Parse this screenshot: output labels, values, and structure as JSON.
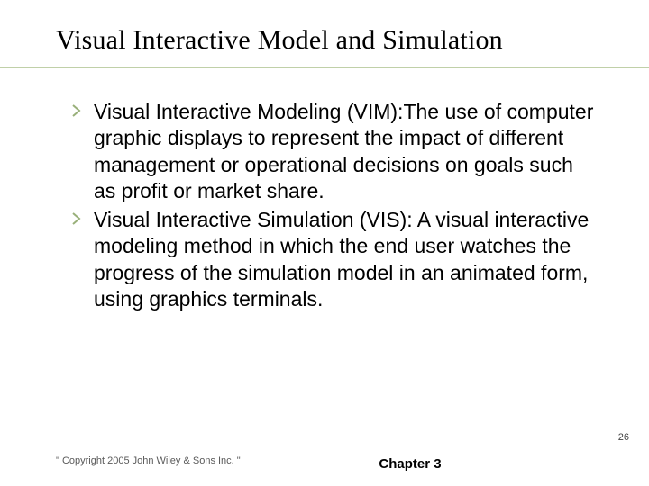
{
  "title": "Visual Interactive Model and Simulation",
  "bullets": [
    {
      "text": "Visual Interactive Modeling (VIM):The use of computer graphic displays to represent the impact of different management or operational decisions on goals such as profit or market share."
    },
    {
      "text": "Visual Interactive Simulation (VIS): A visual interactive modeling method in which  the end user watches the progress of the simulation model in an animated form, using graphics terminals."
    }
  ],
  "footer": {
    "copyright": "\" Copyright 2005 John Wiley & Sons Inc. \"",
    "chapter": "Chapter 3",
    "page": "26"
  },
  "colors": {
    "accent": "#8aa86c"
  }
}
